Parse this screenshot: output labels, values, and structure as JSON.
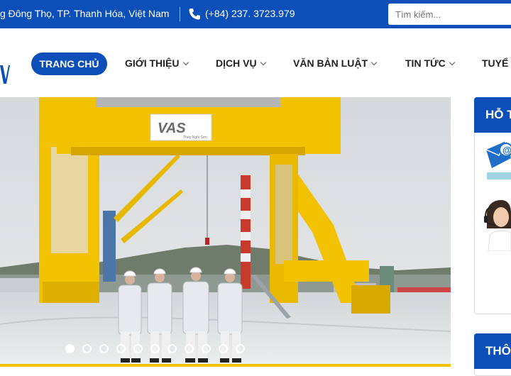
{
  "topbar": {
    "address": "g Đông Thọ, TP. Thanh Hóa, Việt Nam",
    "phone": "(+84) 237. 3723.979",
    "search_placeholder": "Tìm kiếm..."
  },
  "nav": {
    "items": [
      {
        "label": "TRANG CHỦ",
        "active": true
      },
      {
        "label": "GIỚI THIỆU",
        "dropdown": true
      },
      {
        "label": "DỊCH VỤ",
        "dropdown": true
      },
      {
        "label": "VĂN BẢN LUẬT",
        "dropdown": true
      },
      {
        "label": "TIN TỨC",
        "dropdown": true
      },
      {
        "label": "TUYỂ",
        "dropdown": false
      }
    ]
  },
  "hero": {
    "sign_text": "VAS",
    "sign_subtext": "Thép Nghi Sơn",
    "slide_count": 11,
    "active_slide": 1
  },
  "sidebar": {
    "support_title": "HỖ T",
    "info_title": "THÔ"
  },
  "colors": {
    "brand_blue": "#0d4fb9",
    "crane_yellow": "#f2c200",
    "accent_yellow": "#f5c400"
  },
  "icons": [
    "phone-icon",
    "chevron-down-icon",
    "email-icon",
    "support-agent-photo"
  ]
}
